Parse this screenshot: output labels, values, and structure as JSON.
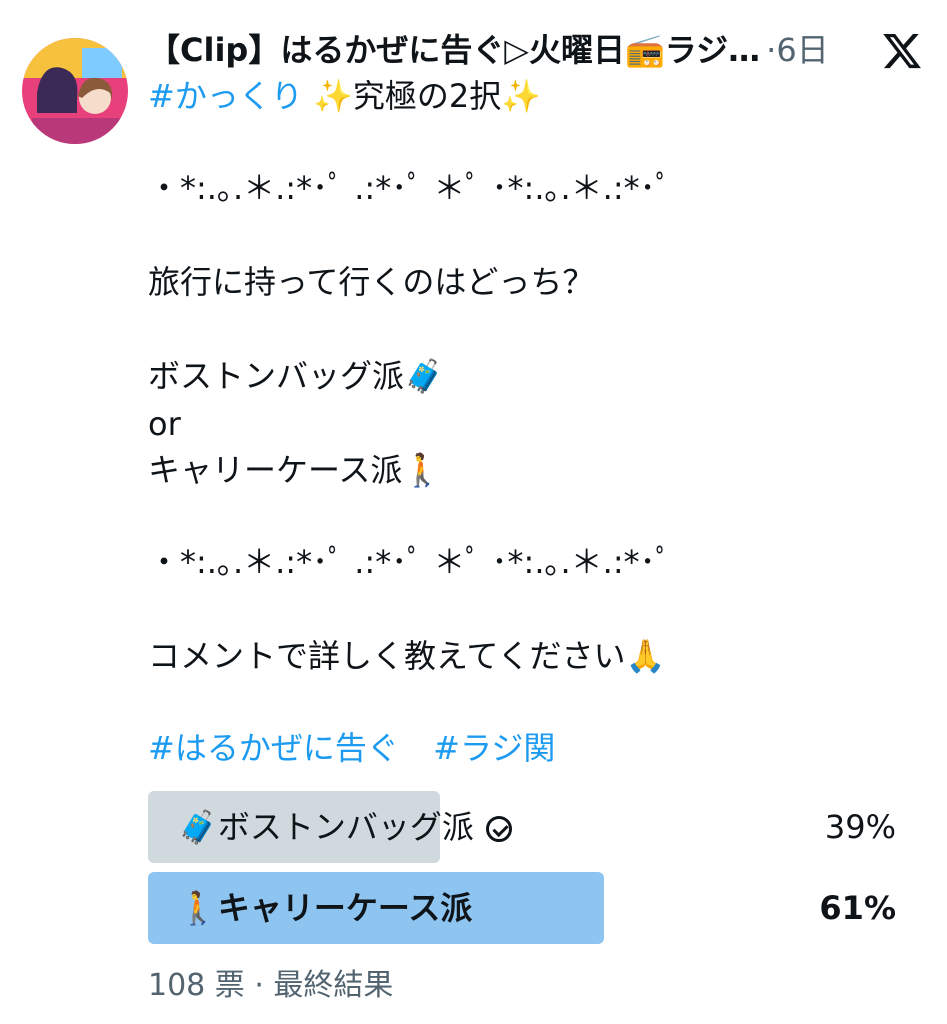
{
  "tweet": {
    "account_name": "【Clip】はるかぜに告ぐ▷火曜日📻ラジ…",
    "time": "·6日",
    "hashtag_line_tag": "#かっくり",
    "hashtag_line_rest": " ✨究極の2択✨",
    "deco_line_1": "・*:.｡.＊.:*･ﾟ .:*･ﾟ ＊ﾟ ･*:.｡.＊.:*･ﾟ",
    "question": "旅行に持って行くのはどっち？",
    "option_a_text": "ボストンバッグ派🧳",
    "or_text": "or",
    "option_b_text": "キャリーケース派🚶",
    "deco_line_2": "・*:.｡.＊.:*･ﾟ .:*･ﾟ ＊ﾟ ･*:.｡.＊.:*･ﾟ",
    "comment_request": "コメントで詳しく教えてください🙏",
    "hashtags": [
      "#はるかぜに告ぐ",
      "#ラジ関"
    ]
  },
  "poll": {
    "options": [
      {
        "label": "🧳ボストンバッグ派",
        "percent": "39%",
        "value": 0.39,
        "bar_color": "#cfd9de",
        "bold": false,
        "voted": true
      },
      {
        "label": "🚶キャリーケース派",
        "percent": "61%",
        "value": 0.61,
        "bar_color": "#8ec5f0",
        "bold": true,
        "voted": false
      }
    ],
    "footer": "108 票 · 最終結果"
  },
  "icons": {
    "avatar": "avatar-image",
    "x_logo": "x-logo-icon",
    "check": "check-circle-icon"
  }
}
